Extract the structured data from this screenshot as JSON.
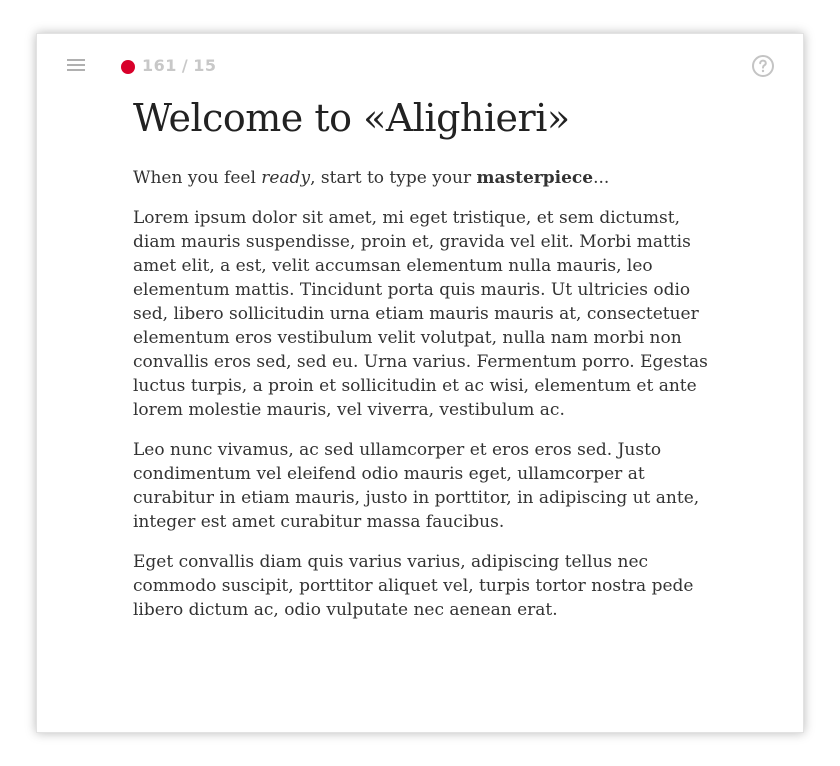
{
  "toolbar": {
    "menu_icon": "hamburger-menu-icon",
    "status_color": "#d8002a",
    "count_left": "161",
    "count_separator": "/",
    "count_right": "15",
    "help_icon": "help-circle-icon"
  },
  "document": {
    "title": "Welcome to «Alighieri»",
    "intro": {
      "part1": "When you feel ",
      "italic": "ready",
      "part2": ", start to type your ",
      "bold": "masterpiece",
      "part3": "..."
    },
    "paragraphs": [
      "Lorem ipsum dolor sit amet, mi eget tristique, et sem dictumst, diam mauris suspendisse, proin et, gravida vel elit. Morbi mattis amet elit, a est, velit accumsan elementum nulla mauris, leo elementum mattis. Tincidunt porta quis mauris. Ut ultricies odio sed, libero sollicitudin urna etiam mauris mauris at, consectetuer elementum eros vestibulum velit volutpat, nulla nam morbi non convallis eros sed, sed eu. Urna varius. Fermentum porro. Egestas luctus turpis, a proin et sollicitudin et ac wisi, elementum et ante lorem molestie mauris, vel viverra, vestibulum ac.",
      "Leo nunc vivamus, ac sed ullamcorper et eros eros sed. Justo condimentum vel eleifend odio mauris eget, ullamcorper at curabitur in etiam mauris, justo in porttitor, in adipiscing ut ante, integer est amet curabitur massa faucibus.",
      "Eget convallis diam quis varius varius, adipiscing tellus nec commodo suscipit, porttitor aliquet vel, turpis tortor nostra pede libero dictum ac, odio vulputate nec aenean erat."
    ]
  }
}
